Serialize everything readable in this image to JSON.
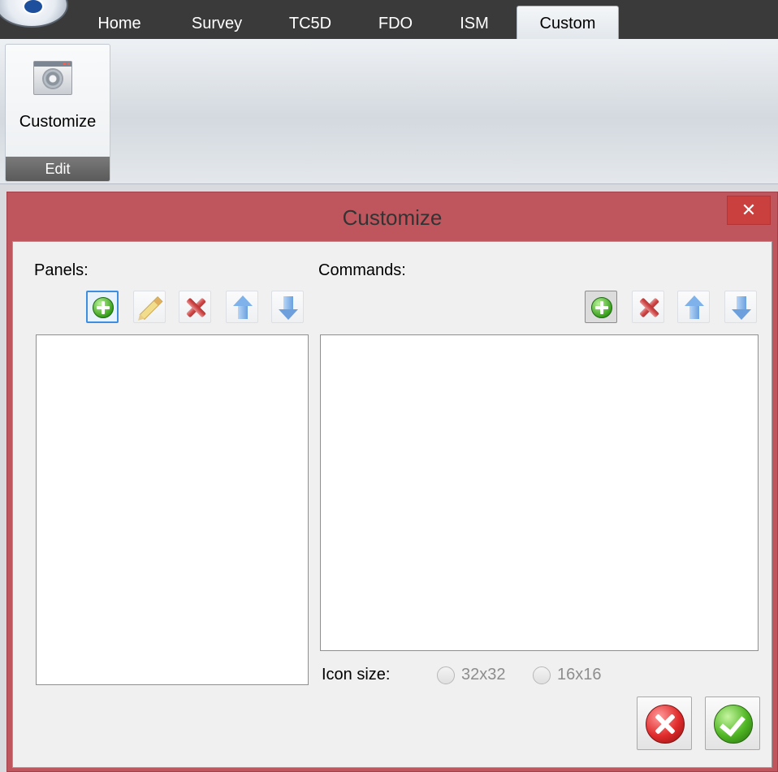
{
  "ribbon": {
    "tabs": [
      {
        "label": "Home"
      },
      {
        "label": "Survey"
      },
      {
        "label": "TC5D"
      },
      {
        "label": "FDO"
      },
      {
        "label": "ISM"
      },
      {
        "label": "Custom"
      }
    ],
    "active_tab": "Custom",
    "group": {
      "button_label": "Customize",
      "group_label": "Edit"
    }
  },
  "dialog": {
    "title": "Customize",
    "close_symbol": "✕",
    "panels": {
      "label": "Panels:",
      "toolbar_icons": [
        "add-icon",
        "edit-pencil-icon",
        "delete-icon",
        "move-up-icon",
        "move-down-icon"
      ]
    },
    "commands": {
      "label": "Commands:",
      "toolbar_icons": [
        "add-icon",
        "delete-icon",
        "move-up-icon",
        "move-down-icon"
      ]
    },
    "icon_size": {
      "label": "Icon size:",
      "options": [
        {
          "label": "32x32",
          "selected": false,
          "enabled": false
        },
        {
          "label": "16x16",
          "selected": false,
          "enabled": false
        }
      ]
    },
    "buttons": {
      "cancel_icon": "red-circle-x-icon",
      "ok_icon": "green-circle-check-icon"
    }
  },
  "colors": {
    "dialog_frame": "#c0565d",
    "tab_bar": "#3a3a3a",
    "focus_blue": "#3d8de0"
  }
}
